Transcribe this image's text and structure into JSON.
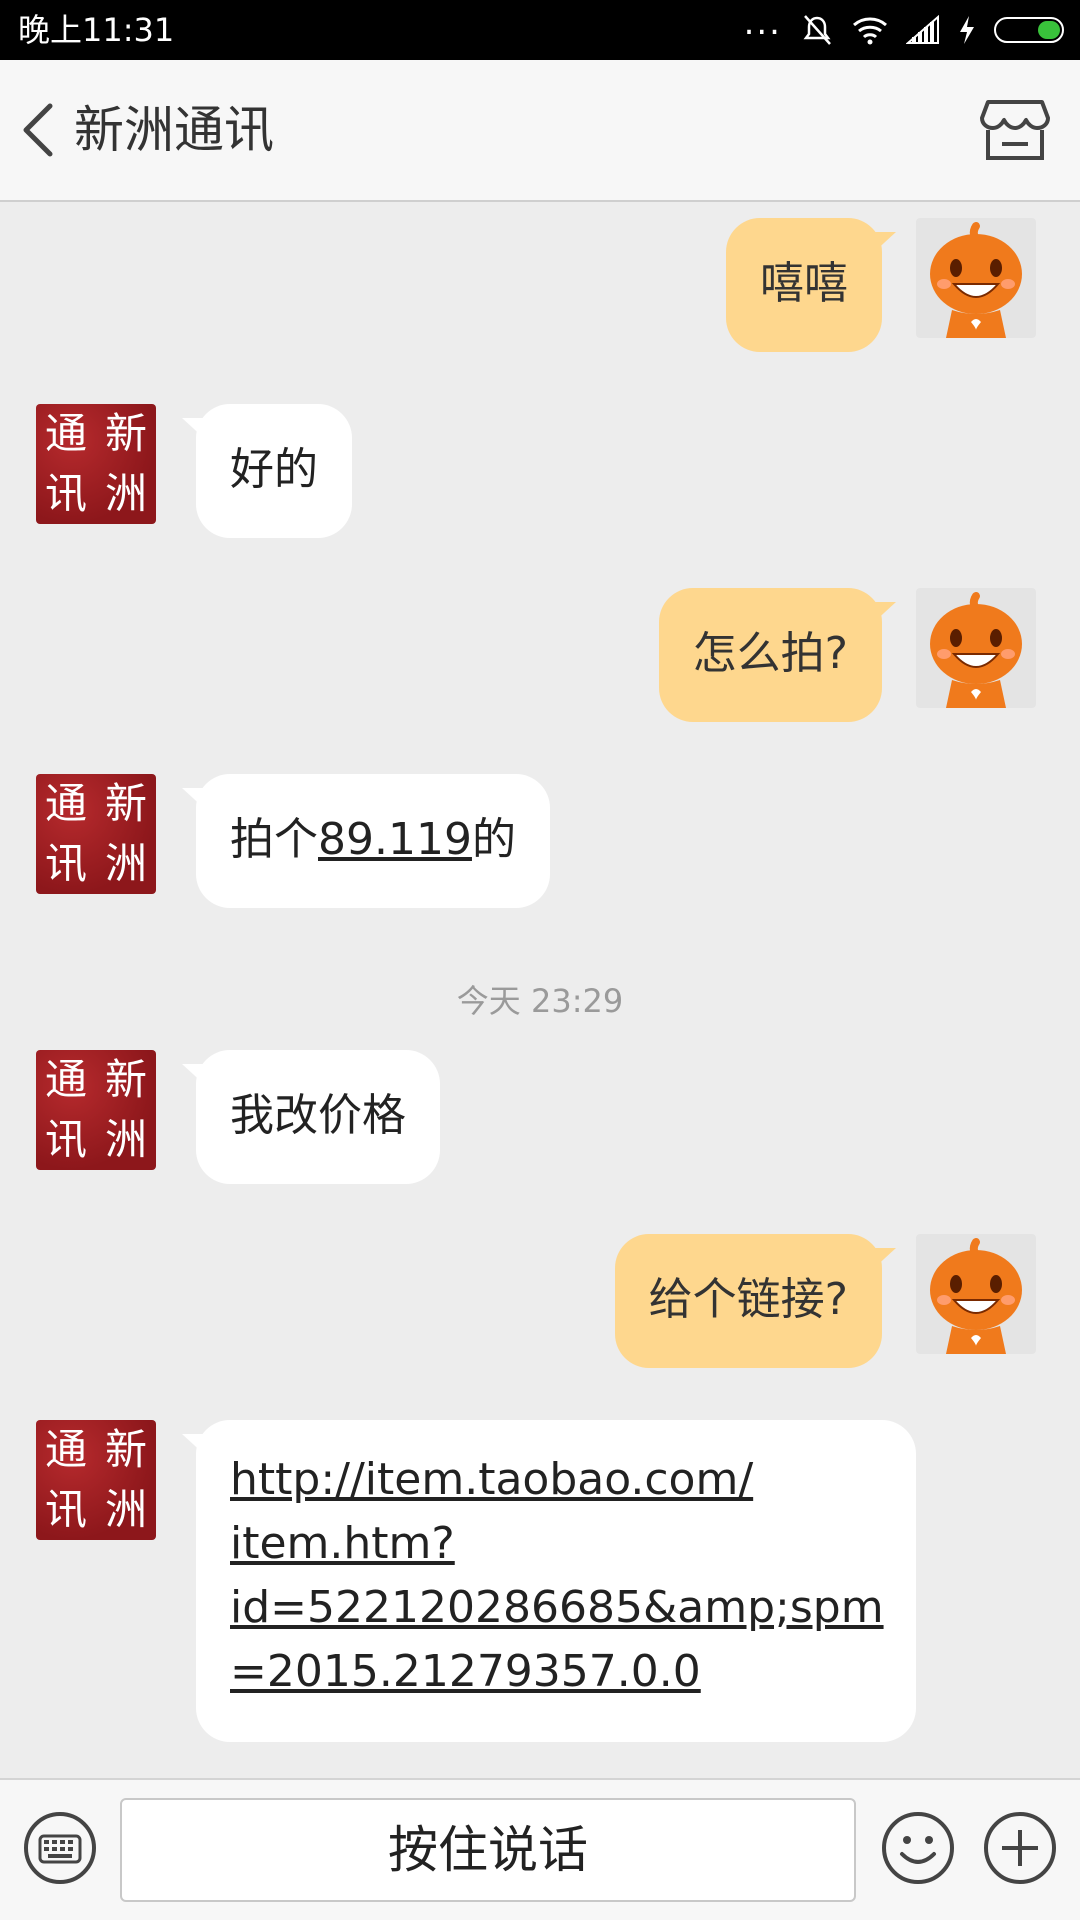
{
  "status_bar": {
    "time": "晚上11:31",
    "dots": "...",
    "icons": [
      "mute-icon",
      "wifi-icon",
      "signal-icon",
      "charging-icon",
      "battery-icon"
    ]
  },
  "header": {
    "title": "新洲通讯",
    "back_icon": "chevron-left-icon",
    "shop_icon": "store-icon"
  },
  "shop_avatar": [
    "通",
    "新",
    "讯",
    "洲"
  ],
  "messages": [
    {
      "side": "out",
      "text": "嘻嘻"
    },
    {
      "side": "in",
      "text": "好的"
    },
    {
      "side": "out",
      "text": "怎么拍?"
    },
    {
      "side": "in",
      "text_pre": "拍个",
      "link": "89.119",
      "text_post": "的"
    },
    {
      "timestamp": "今天 23:29"
    },
    {
      "side": "in",
      "text": "我改价格"
    },
    {
      "side": "out",
      "text": "给个链接?"
    },
    {
      "side": "in",
      "link_lines": [
        "http://item.taobao.com/",
        "item.htm?",
        "id=522120286685&amp;spm",
        "=2015.21279357.0.0"
      ]
    }
  ],
  "input_bar": {
    "voice_label": "按住说话",
    "icons": [
      "keyboard-icon",
      "emoji-icon",
      "plus-icon"
    ]
  },
  "colors": {
    "outgoing_bubble": "#fed78e",
    "incoming_bubble": "#ffffff",
    "background": "#ededed",
    "shop_avatar": "#9b1e22",
    "battery": "#39c23b"
  }
}
